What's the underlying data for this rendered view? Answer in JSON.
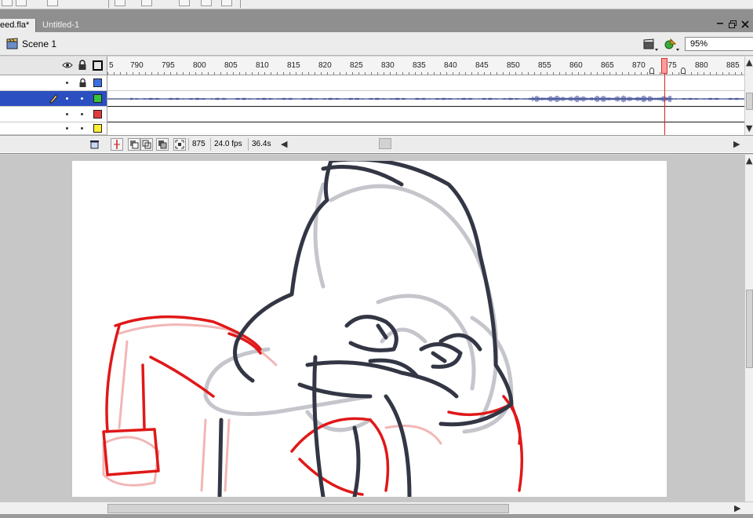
{
  "document_tabs": {
    "active": "eed.fla*",
    "inactive": "Untitled-1"
  },
  "window_controls": {
    "restore": "▭",
    "maximize": "▫",
    "close": "✕"
  },
  "scene_bar": {
    "scene_label": "Scene 1",
    "zoom": "95%",
    "edit_scene_icon": "clapperboard-icon",
    "edit_symbol_icon": "symbol-icon"
  },
  "timeline": {
    "ruler_ticks": [
      "5",
      "790",
      "795",
      "800",
      "805",
      "810",
      "815",
      "820",
      "825",
      "830",
      "835",
      "840",
      "845",
      "850",
      "855",
      "860",
      "865",
      "870",
      "875",
      "880",
      "885"
    ],
    "current_frame": "875",
    "fps": "24.0 fps",
    "elapsed": "36.4s",
    "layers": [
      {
        "color": "#3a6fe0",
        "selected": false,
        "locked": false
      },
      {
        "color": "#39c43a",
        "selected": true,
        "locked": false
      },
      {
        "color": "#e23b3b",
        "selected": false,
        "locked": false
      },
      {
        "color": "#ffee33",
        "selected": false,
        "locked": false
      }
    ]
  },
  "icons": {
    "eye": "eye-icon",
    "lock": "lock-icon",
    "outline": "outline-icon",
    "pencil": "pencil-icon",
    "trash": "trash-icon"
  }
}
